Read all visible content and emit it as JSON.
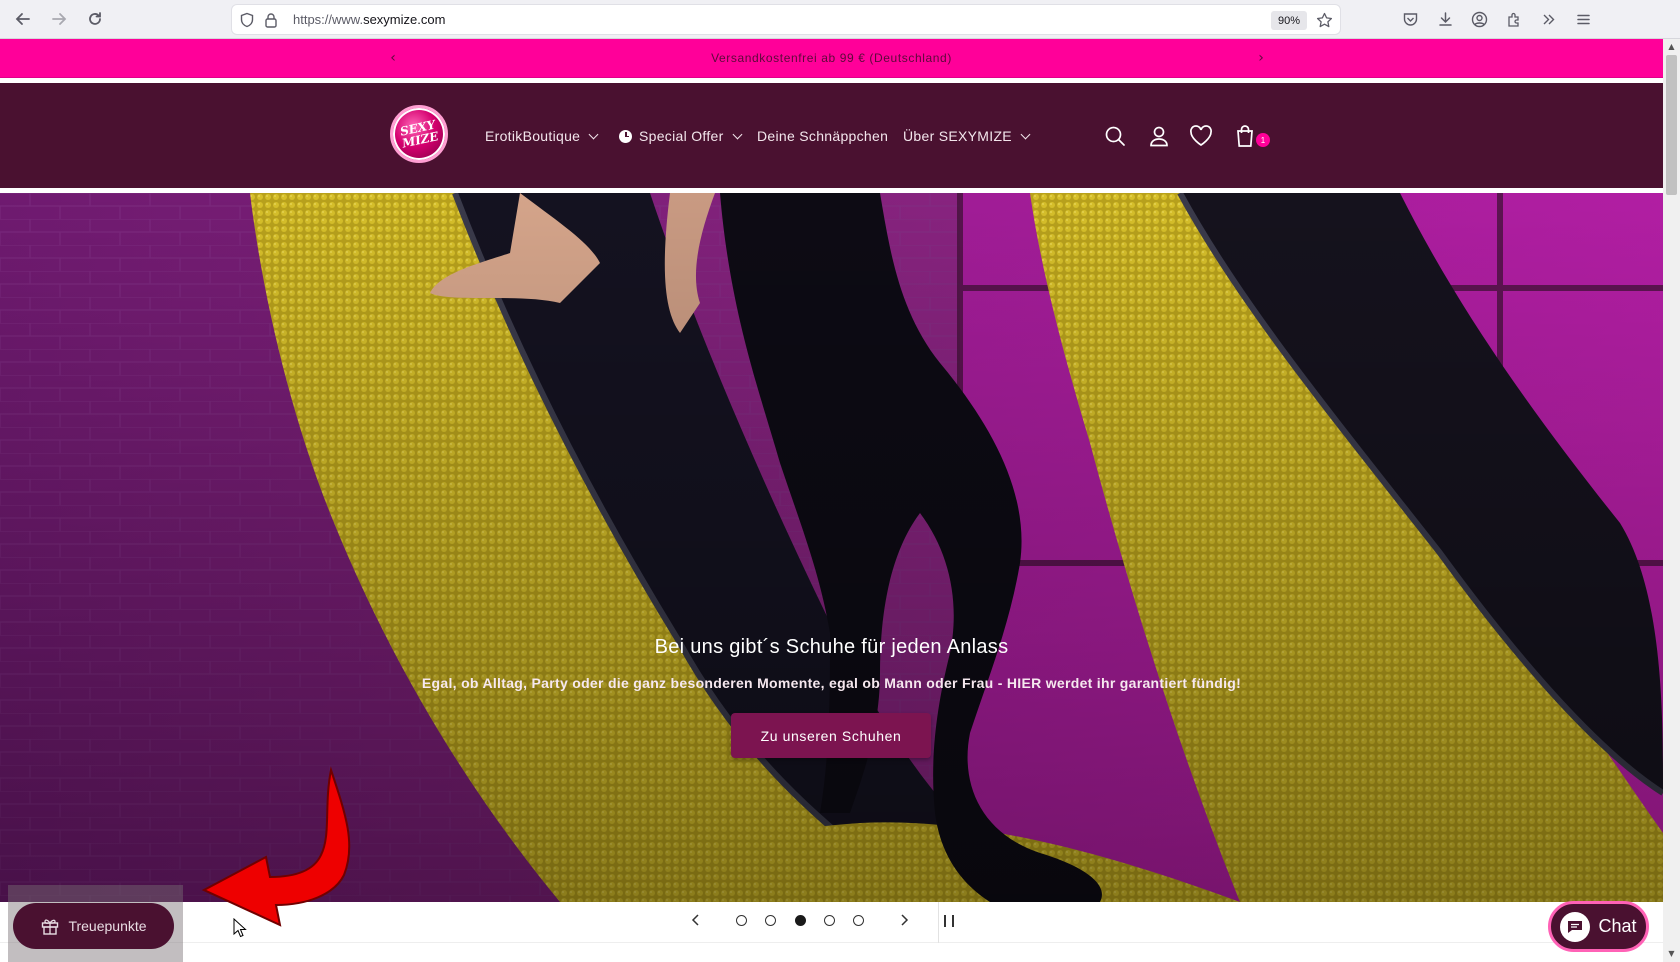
{
  "browser": {
    "url_scheme": "https://www.",
    "url_host": "sexymize.com",
    "zoom": "90%",
    "icons": [
      "back-arrow-icon",
      "forward-arrow-icon",
      "reload-icon",
      "shield-icon",
      "lock-icon",
      "star-icon",
      "pocket-icon",
      "download-icon",
      "account-icon",
      "extensions-icon",
      "overflow-icon",
      "menu-icon"
    ]
  },
  "announcement": {
    "text": "Versandkostenfrei ab 99 € (Deutschland)"
  },
  "header": {
    "logo_text": "SEXY MIZE",
    "menu": [
      {
        "label": "ErotikBoutique",
        "dropdown": true
      },
      {
        "label": "Special Offer",
        "dropdown": true
      },
      {
        "label": "Deine Schnäppchen",
        "dropdown": false
      },
      {
        "label": "Über SEXYMIZE",
        "dropdown": true
      }
    ],
    "cart_count": "1"
  },
  "hero": {
    "title": "Bei uns gibt´s Schuhe für jeden Anlass",
    "subtitle": "Egal, ob Alltag, Party oder die ganz besonderen Momente, egal ob Mann oder Frau - HIER werdet ihr garantiert fündig!",
    "button": "Zu unseren Schuhen"
  },
  "slider": {
    "slides": 5,
    "active_index": 2
  },
  "loyalty": {
    "label": "Treuepunkte"
  },
  "chat": {
    "label": "Chat"
  },
  "colors": {
    "announcement_bg": "#ff0099",
    "header_bg": "#4a1130",
    "button_bg": "#7c1450",
    "accent_pink": "#ff62b6"
  }
}
